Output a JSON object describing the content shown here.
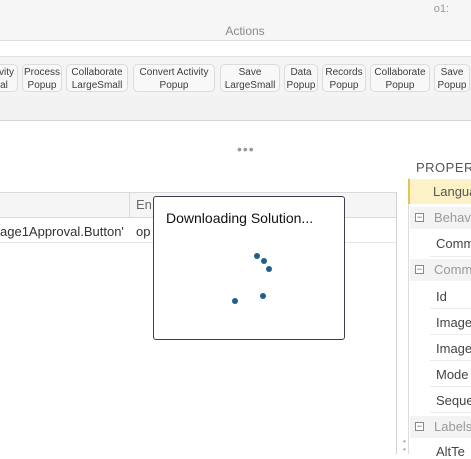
{
  "ribbon": {
    "corner_text": "o1:",
    "group_label": "Actions",
    "buttons": [
      {
        "line1": "tivity",
        "line2": "al"
      },
      {
        "line1": "Process",
        "line2": "Popup"
      },
      {
        "line1": "Collaborate",
        "line2": "LargeSmall"
      },
      {
        "line1": "Convert Activity",
        "line2": "Popup"
      },
      {
        "line1": "Save",
        "line2": "LargeSmall"
      },
      {
        "line1": "Data",
        "line2": "Popup"
      },
      {
        "line1": "Records",
        "line2": "Popup"
      },
      {
        "line1": "Collaborate",
        "line2": "Popup"
      },
      {
        "line1": "Save",
        "line2": "Popup"
      }
    ]
  },
  "more_dots": "•••",
  "grid": {
    "header_second": "En",
    "row1_first": "age1Approval.Button'",
    "row1_second": "op"
  },
  "properties": {
    "title": "PROPERT",
    "language_row": "Langua",
    "sections": [
      {
        "label": "Behav",
        "items": [
          "Comm"
        ]
      },
      {
        "label": "Comm",
        "items": [
          "Id",
          "Image",
          "Image",
          "Mode",
          "Seque"
        ]
      },
      {
        "label": "Labels",
        "items": [
          "AltTe"
        ]
      }
    ],
    "toggle_symbol": "−"
  },
  "dialog": {
    "title": "Downloading Solution..."
  }
}
